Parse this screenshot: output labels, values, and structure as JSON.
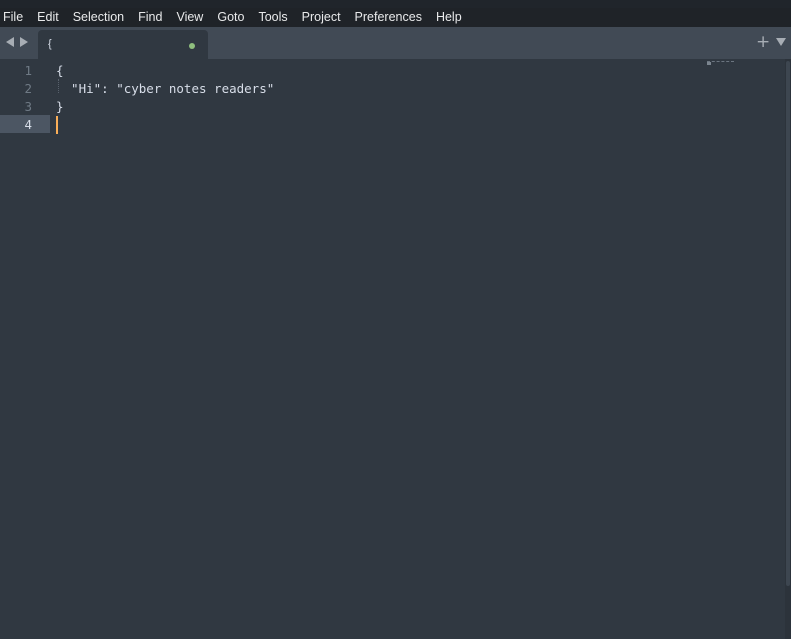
{
  "menu": {
    "items": [
      "File",
      "Edit",
      "Selection",
      "Find",
      "View",
      "Goto",
      "Tools",
      "Project",
      "Preferences",
      "Help"
    ]
  },
  "tabbar": {
    "tab_title": "{",
    "new_tab_label": "+"
  },
  "editor": {
    "line_numbers": [
      "1",
      "2",
      "3",
      "4"
    ],
    "lines": [
      "{",
      "  \"Hi\": \"cyber notes readers\"",
      "}",
      ""
    ],
    "current_line": "4"
  },
  "colors": {
    "background": "#303841",
    "menubar": "#1f2328",
    "tabbar": "#414a55",
    "caret": "#f9ae58",
    "dirty_indicator": "#8fbf7e"
  }
}
